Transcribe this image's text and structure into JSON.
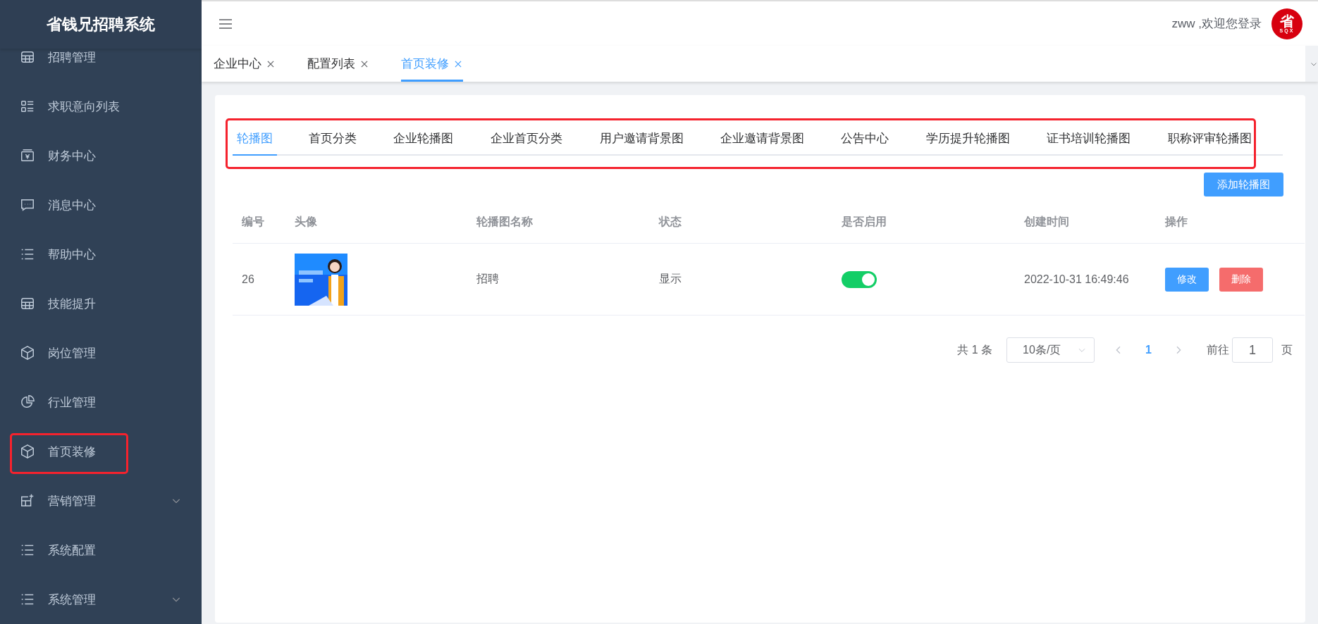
{
  "sidebar": {
    "title": "省钱兄招聘系统",
    "items": [
      {
        "label": "招聘管理",
        "kind": "item",
        "selected": false,
        "highlighted": false
      },
      {
        "label": "求职意向列表",
        "kind": "item",
        "selected": false,
        "highlighted": false
      },
      {
        "label": "财务中心",
        "kind": "item",
        "selected": false,
        "highlighted": false
      },
      {
        "label": "消息中心",
        "kind": "item",
        "selected": false,
        "highlighted": false
      },
      {
        "label": "帮助中心",
        "kind": "item",
        "selected": false,
        "highlighted": false
      },
      {
        "label": "技能提升",
        "kind": "item",
        "selected": false,
        "highlighted": false
      },
      {
        "label": "岗位管理",
        "kind": "item",
        "selected": false,
        "highlighted": false
      },
      {
        "label": "行业管理",
        "kind": "item",
        "selected": false,
        "highlighted": false
      },
      {
        "label": "首页装修",
        "kind": "item",
        "selected": false,
        "highlighted": true
      },
      {
        "label": "营销管理",
        "kind": "submenu",
        "selected": false,
        "highlighted": false
      },
      {
        "label": "系统配置",
        "kind": "item",
        "selected": false,
        "highlighted": false
      },
      {
        "label": "系统管理",
        "kind": "submenu",
        "selected": false,
        "highlighted": false
      }
    ]
  },
  "header": {
    "greeting": "zww ,欢迎您登录",
    "logo": {
      "glyph": "省",
      "caption": "SQX"
    }
  },
  "page_tabs": [
    {
      "label": "企业中心",
      "selected": false
    },
    {
      "label": "配置列表",
      "selected": false
    },
    {
      "label": "首页装修",
      "selected": true
    }
  ],
  "content_tabs": {
    "highlighted": true,
    "items": [
      {
        "label": "轮播图",
        "selected": true
      },
      {
        "label": "首页分类",
        "selected": false
      },
      {
        "label": "企业轮播图",
        "selected": false
      },
      {
        "label": "企业首页分类",
        "selected": false
      },
      {
        "label": "用户邀请背景图",
        "selected": false
      },
      {
        "label": "企业邀请背景图",
        "selected": false
      },
      {
        "label": "公告中心",
        "selected": false
      },
      {
        "label": "学历提升轮播图",
        "selected": false
      },
      {
        "label": "证书培训轮播图",
        "selected": false
      },
      {
        "label": "职称评审轮播图",
        "selected": false
      }
    ]
  },
  "add_button": "添加轮播图",
  "table": {
    "columns": [
      "编号",
      "头像",
      "轮播图名称",
      "状态",
      "是否启用",
      "创建时间",
      "操作"
    ],
    "rows": [
      {
        "id": "26",
        "avatar": {
          "kind": "picture"
        },
        "name": "招聘",
        "status": "显示",
        "enabled": true,
        "created": "2022-10-31 16:49:46",
        "actions": [
          "修改",
          "删除"
        ]
      }
    ]
  },
  "pagination": {
    "total": "共 1 条",
    "page_size": "10条/页",
    "pages": [
      {
        "label": "1",
        "selected": true
      }
    ],
    "goto_label": "前往",
    "goto_value": "1",
    "goto_suffix": "页"
  }
}
